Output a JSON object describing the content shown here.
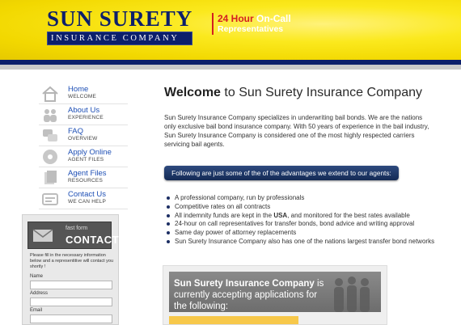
{
  "header": {
    "logo_top": "SUN SURETY",
    "logo_bottom": "INSURANCE COMPANY",
    "oncall_hours": "24 Hour",
    "oncall_label": "On-Call",
    "oncall_sub": "Representatives"
  },
  "nav": [
    {
      "title": "Home",
      "sub": "WELCOME",
      "icon": "house-icon"
    },
    {
      "title": "About Us",
      "sub": "EXPERIENCE",
      "icon": "people-icon"
    },
    {
      "title": "FAQ",
      "sub": "OVERVIEW",
      "icon": "chat-icon"
    },
    {
      "title": "Apply Online",
      "sub": "AGENT FILES",
      "icon": "disc-icon"
    },
    {
      "title": "Agent Files",
      "sub": "RESOURCES",
      "icon": "files-icon"
    },
    {
      "title": "Contact Us",
      "sub": "WE CAN HELP",
      "icon": "card-icon"
    }
  ],
  "fastform": {
    "small": "fast form",
    "big": "CONTACT",
    "text": "Please fill in the necessary information below and a representitive will contact you shortly !",
    "labels": {
      "name": "Name",
      "address": "Address",
      "email": "Email"
    }
  },
  "main": {
    "welcome_bold": "Welcome",
    "welcome_rest": "to Sun Surety Insurance Company",
    "intro": "Sun Surety Insurance Company specializes in underwriting bail bonds. We are the nations only exclusive bail bond insurance company. With 50 years of experience in the bail industry, Sun Surety Insurance Company is considered one of the most highly respected carriers servicing bail agents.",
    "banner": "Following are just some of the of the advantages we extend to our agents:",
    "advantages": [
      "A professional company, run by professionals",
      "Competitive rates on all contracts",
      "24-hour on call representatives for transfer bonds, bond advice and writing approval",
      "Same day power of attorney replacements",
      "Sun Surety Insurance Company also has one of the nations largest transfer bond networks"
    ],
    "indemnity_pre": "All indemnity funds are kept in the",
    "indemnity_usa": "USA",
    "indemnity_post": ", and monitored for the best rates available",
    "apply_bold": "Sun Surety Insurance Company",
    "apply_rest": " is currently accepting applications for the following:"
  },
  "colors": {
    "navy": "#0c1f6b",
    "yellow": "#f2d800",
    "red": "#d41f1f",
    "link": "#1e4fb5"
  }
}
